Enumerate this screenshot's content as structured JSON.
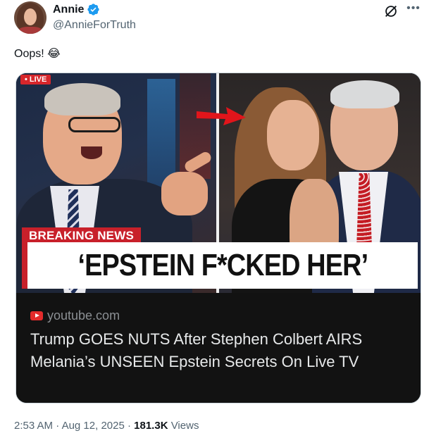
{
  "author": {
    "display_name": "Annie",
    "handle": "@AnnieForTruth",
    "verified_badge_icon": "verified-badge-icon",
    "verified_color": "#1d9bf0"
  },
  "tweet": {
    "text": "Oops! 😂"
  },
  "media": {
    "live_tag": "• LIVE",
    "breaking_news": "BREAKING NEWS",
    "headline": "‘EPSTEIN F*CKED HER’",
    "link_domain": "youtube.com",
    "link_title": "Trump GOES NUTS After Stephen Colbert AIRS Melania’s UNSEEN Epstein Secrets On Live TV"
  },
  "meta": {
    "time": "2:53 AM",
    "date": "Aug 12, 2025",
    "views_count": "181.3K",
    "views_label": "Views"
  },
  "colors": {
    "accent_red": "#c8202a",
    "text_secondary": "#536471"
  }
}
